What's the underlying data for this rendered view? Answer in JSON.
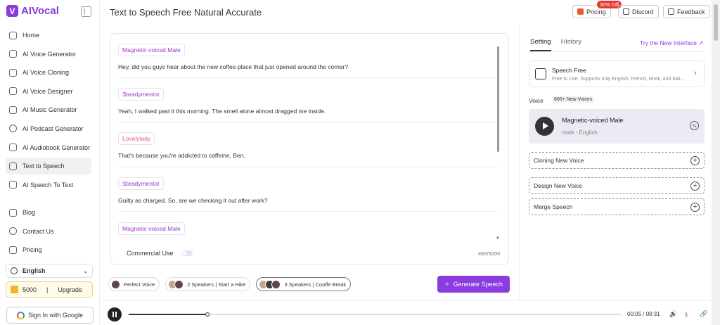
{
  "app": {
    "name": "AIVocal",
    "logo_letter": "V"
  },
  "sidebar": {
    "items": [
      {
        "label": "Home"
      },
      {
        "label": "AI Voice Generator"
      },
      {
        "label": "AI Voice Cloning"
      },
      {
        "label": "AI Voice Designer"
      },
      {
        "label": "AI Music Generator"
      },
      {
        "label": "AI Podcast Generator"
      },
      {
        "label": "AI Audiobook Generator"
      },
      {
        "label": "Text to Speech",
        "active": true
      },
      {
        "label": "AI Speech To Text"
      }
    ],
    "items2": [
      {
        "label": "Blog"
      },
      {
        "label": "Contact Us"
      },
      {
        "label": "Pricing"
      }
    ],
    "language": "English",
    "credits": "5000",
    "credits_sep": "|",
    "upgrade": "Upgrade",
    "signin": "Sign In with Google"
  },
  "header": {
    "title": "Text to Speech Free Natural Accurate",
    "pricing": "Pricing",
    "sale_badge": "30% Off",
    "discord": "Discord",
    "feedback": "Feedback"
  },
  "editor": {
    "dialogs": [
      {
        "speaker": "Magnetic-voiced Male",
        "text": "Hey, did you guys hear about the new coffee place that just opened around the corner?"
      },
      {
        "speaker": "Steadymentor",
        "text": "Yeah, I walked past it this morning. The smell alone almost dragged me inside."
      },
      {
        "speaker": "Lovelylady",
        "text": "That's because you're addicted to caffeine, Ben."
      },
      {
        "speaker": "Steadymentor",
        "text": "Guilty as charged. So, are we checking it out after work?"
      },
      {
        "speaker": "Magnetic-voiced Male",
        "text": ""
      }
    ],
    "commercial_label": "Commercial Use",
    "char_count": "465/5000"
  },
  "presets": [
    {
      "label": "Perfect Voice"
    },
    {
      "label": "2 Speakers | Start a Hike"
    },
    {
      "label": "3 Speakers | Cooffe Break"
    }
  ],
  "generate_label": "Generate Speech",
  "panel": {
    "tabs": [
      "Setting",
      "History"
    ],
    "try_new": "Try the New Interface ↗",
    "speech_free_title": "Speech Free",
    "speech_free_desc": "Free to Use. Supports only English, French, Hindi, and Itali...",
    "voice_label": "Voice",
    "new_voices": "600+ New Voices",
    "voice_name": "Magnetic-voiced Male",
    "voice_sub": "male - English",
    "cloning": "Cloning New Voice",
    "design": "Design New Voice",
    "merge": "Merge Speech"
  },
  "player": {
    "time": "00:05 / 00:31",
    "progress": 0.16
  }
}
